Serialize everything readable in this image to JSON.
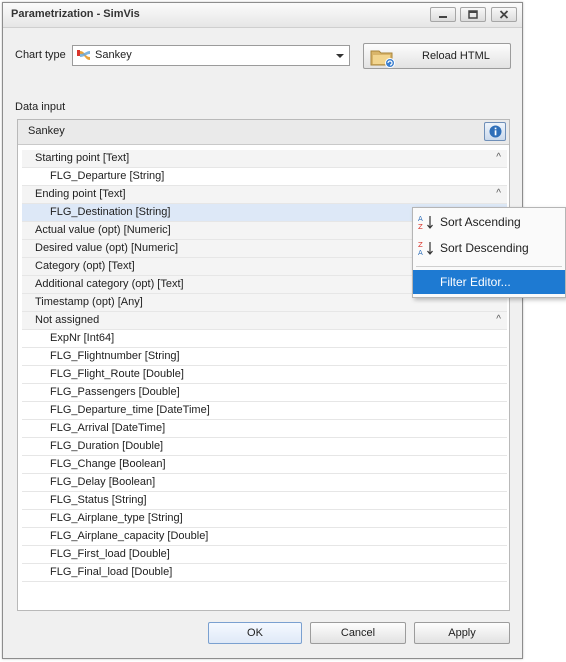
{
  "window": {
    "title": "Parametrization - SimVis"
  },
  "chart_type": {
    "label": "Chart type",
    "value": "Sankey",
    "icon": "sankey-icon"
  },
  "reload_button": {
    "label": "Reload HTML",
    "icon": "folder-reload-icon"
  },
  "data_input": {
    "label": "Data input",
    "panel_title": "Sankey"
  },
  "rows": [
    {
      "kind": "group",
      "text": "Starting point [Text]",
      "chevron": "^"
    },
    {
      "kind": "item",
      "text": "FLG_Departure [String]"
    },
    {
      "kind": "group",
      "text": "Ending point [Text]",
      "chevron": "^"
    },
    {
      "kind": "item",
      "text": "FLG_Destination [String]",
      "selected": true
    },
    {
      "kind": "group",
      "text": "Actual value (opt) [Numeric]"
    },
    {
      "kind": "group",
      "text": "Desired value (opt) [Numeric]"
    },
    {
      "kind": "group",
      "text": "Category (opt) [Text]"
    },
    {
      "kind": "group",
      "text": "Additional category (opt) [Text]"
    },
    {
      "kind": "group",
      "text": "Timestamp (opt) [Any]"
    },
    {
      "kind": "group",
      "text": "Not assigned",
      "chevron": "^"
    },
    {
      "kind": "item",
      "text": "ExpNr [Int64]"
    },
    {
      "kind": "item",
      "text": "FLG_Flightnumber [String]"
    },
    {
      "kind": "item",
      "text": "FLG_Flight_Route [Double]"
    },
    {
      "kind": "item",
      "text": "FLG_Passengers [Double]"
    },
    {
      "kind": "item",
      "text": "FLG_Departure_time [DateTime]"
    },
    {
      "kind": "item",
      "text": "FLG_Arrival [DateTime]"
    },
    {
      "kind": "item",
      "text": "FLG_Duration [Double]"
    },
    {
      "kind": "item",
      "text": "FLG_Change [Boolean]"
    },
    {
      "kind": "item",
      "text": "FLG_Delay [Boolean]"
    },
    {
      "kind": "item",
      "text": "FLG_Status [String]"
    },
    {
      "kind": "item",
      "text": "FLG_Airplane_type [String]"
    },
    {
      "kind": "item",
      "text": "FLG_Airplane_capacity [Double]"
    },
    {
      "kind": "item",
      "text": "FLG_First_load [Double]"
    },
    {
      "kind": "item",
      "text": "FLG_Final_load [Double]"
    }
  ],
  "context_menu": {
    "sort_ascending": "Sort Ascending",
    "sort_descending": "Sort Descending",
    "filter_editor": "Filter Editor..."
  },
  "footer": {
    "ok": "OK",
    "cancel": "Cancel",
    "apply": "Apply"
  },
  "colors": {
    "menu_highlight": "#1e7ad2",
    "selected_row": "#dde8f7",
    "accent_red": "#d9342b"
  }
}
